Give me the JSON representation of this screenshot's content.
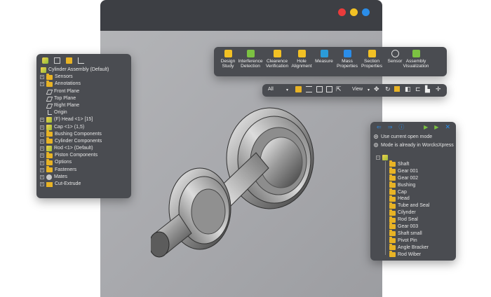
{
  "window": {
    "dots": [
      "#ea3b3b",
      "#f2c124",
      "#2b8de8"
    ]
  },
  "feature_tree": {
    "header_icons": [
      "part-icon",
      "property-icon",
      "config-icon",
      "dim-icon"
    ],
    "items": [
      {
        "label": "Cylinder Assembly (Default)",
        "icon": "assembly",
        "exp": "none",
        "indent": 0
      },
      {
        "label": "Sensors",
        "icon": "folder",
        "exp": "plus",
        "indent": 1
      },
      {
        "label": "Annotations",
        "icon": "folder",
        "exp": "plus",
        "indent": 1
      },
      {
        "label": "Front Plane",
        "icon": "plane",
        "exp": "none",
        "indent": 1
      },
      {
        "label": "Top Plane",
        "icon": "plane",
        "exp": "none",
        "indent": 1
      },
      {
        "label": "Right Plane",
        "icon": "plane",
        "exp": "none",
        "indent": 1
      },
      {
        "label": "Origin",
        "icon": "origin",
        "exp": "none",
        "indent": 1
      },
      {
        "label": "(F) Head <1> [15]",
        "icon": "part",
        "exp": "plus",
        "indent": 1
      },
      {
        "label": "Cap <1> (1,5)",
        "icon": "part",
        "exp": "plus",
        "indent": 1
      },
      {
        "label": "Bushing Components",
        "icon": "folder",
        "exp": "plus",
        "indent": 1
      },
      {
        "label": "Cylinder Components",
        "icon": "folder",
        "exp": "plus",
        "indent": 1
      },
      {
        "label": "Rod <1> (Default)",
        "icon": "part",
        "exp": "plus",
        "indent": 1
      },
      {
        "label": "Piston Components",
        "icon": "folder",
        "exp": "plus",
        "indent": 1
      },
      {
        "label": "Options",
        "icon": "folder",
        "exp": "plus",
        "indent": 1
      },
      {
        "label": "Fasteners",
        "icon": "folder",
        "exp": "plus",
        "indent": 1
      },
      {
        "label": "Mates",
        "icon": "mates",
        "exp": "plus",
        "indent": 1
      },
      {
        "label": "Cut-Extrude",
        "icon": "cut",
        "exp": "plus",
        "indent": 1
      }
    ]
  },
  "evaluate_toolbar": {
    "tools": [
      {
        "label1": "Design",
        "label2": "Study",
        "icon": "design-study-icon",
        "color": "#f2c124"
      },
      {
        "label1": "Interference",
        "label2": "Detection",
        "icon": "interference-icon",
        "color": "#7cc242"
      },
      {
        "label1": "Clearence",
        "label2": "Verification",
        "icon": "clearance-icon",
        "color": "#f2c124"
      },
      {
        "label1": "Hole",
        "label2": "Alignment",
        "icon": "hole-alignment-icon",
        "color": "#f2c124"
      },
      {
        "label1": "Measure",
        "label2": "",
        "icon": "measure-icon",
        "color": "#2b9bd8"
      },
      {
        "label1": "Mass",
        "label2": "Properties",
        "icon": "mass-properties-icon",
        "color": "#2b8de8"
      },
      {
        "label1": "Section",
        "label2": "Properties",
        "icon": "section-properties-icon",
        "color": "#f2c124"
      },
      {
        "label1": "Sensor",
        "label2": "",
        "icon": "sensor-icon",
        "color": "#dddddd"
      },
      {
        "label1": "Assembly",
        "label2": "Visualization",
        "icon": "assembly-visualization-icon",
        "color": "#7cc242"
      }
    ]
  },
  "view_bar": {
    "filter_value": "All",
    "view_label": "View"
  },
  "mode_panel": {
    "option1": "Use current open mode",
    "option2": "Mode is already in WorcksXpress",
    "items": [
      "Shaft",
      "Gear 001",
      "Gear 002",
      "Bushing",
      "Cap",
      "Head",
      "Tube and Seal",
      "Cilynder",
      "Rod Seal",
      "Gear 003",
      "Shaft small",
      "Pivot Pin",
      "Angle Bracker",
      "Rod Wiber"
    ]
  }
}
